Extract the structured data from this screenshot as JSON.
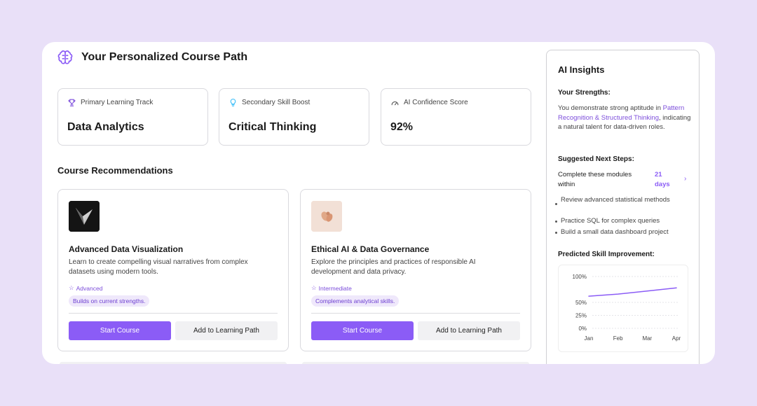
{
  "header": {
    "title": "Your Personalized Course Path"
  },
  "stats": [
    {
      "label": "Primary Learning Track",
      "value": "Data Analytics",
      "icon": "trophy-icon"
    },
    {
      "label": "Secondary Skill Boost",
      "value": "Critical Thinking",
      "icon": "lightbulb-icon"
    },
    {
      "label": "AI Confidence Score",
      "value": "92%",
      "icon": "gauge-icon"
    }
  ],
  "recommendations": {
    "title": "Course Recommendations",
    "courses": [
      {
        "title": "Advanced Data Visualization",
        "description": "Learn to create compelling visual narratives from complex datasets using modern tools.",
        "level": "Advanced",
        "chip": "Builds on current strengths.",
        "primary_label": "Start Course",
        "secondary_label": "Add to Learning Path"
      },
      {
        "title": "Ethical AI & Data Governance",
        "description": "Explore the principles and practices of responsible AI development and data privacy.",
        "level": "Intermediate",
        "chip": "Complements analytical skills.",
        "primary_label": "Start Course",
        "secondary_label": "Add to Learning Path"
      }
    ]
  },
  "insights": {
    "title": "AI Insights",
    "strengths_heading": "Your Strengths:",
    "strengths_pre": "You demonstrate strong aptitude in ",
    "strengths_highlight": "Pattern Recognition & Structured Thinking",
    "strengths_post": ", indicating a natural talent for data-driven roles.",
    "next_heading": "Suggested Next Steps:",
    "next_text": "Complete these modules within",
    "next_days": "21 days",
    "bullets": [
      "Review advanced statistical methods",
      "Practice SQL for complex queries",
      "Build a small data dashboard project"
    ],
    "predicted_heading": "Predicted Skill Improvement:"
  },
  "chart_data": {
    "type": "line",
    "categories": [
      "Jan",
      "Feb",
      "Mar",
      "Apr"
    ],
    "series": [
      {
        "values": [
          62,
          66,
          72,
          78
        ]
      }
    ],
    "ytick_labels": [
      "100%",
      "50%",
      "25%",
      "0%"
    ],
    "ytick_values": [
      100,
      50,
      25,
      0
    ],
    "ylim": [
      0,
      100
    ],
    "grid": true,
    "color": "#8b5cf6"
  },
  "colors": {
    "accent": "#8b5cf6",
    "background": "#e9e0f8"
  }
}
